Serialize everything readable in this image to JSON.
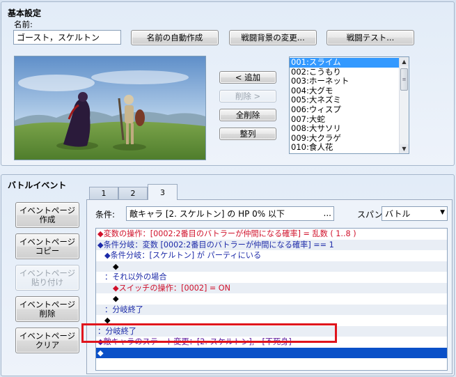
{
  "basic_settings": {
    "title": "基本設定",
    "name_label": "名前:",
    "name_value": "ゴースト，スケルトン",
    "auto_name_button": "名前の自動作成",
    "change_bg_button": "戦闘背景の変更...",
    "battle_test_button": "戦闘テスト...",
    "add_button": "< 追加",
    "remove_button": "削除 >",
    "clear_all_button": "全削除",
    "align_button": "整列"
  },
  "enemy_list": [
    "001:スライム",
    "002:こうもり",
    "003:ホーネット",
    "004:大グモ",
    "005:大ネズミ",
    "006:ウィスプ",
    "007:大蛇",
    "008:大サソリ",
    "009:大クラゲ",
    "010:食人花"
  ],
  "battle_event": {
    "title": "バトルイベント",
    "tabs": [
      "1",
      "2",
      "3"
    ],
    "active_tab": "3",
    "side_buttons": [
      {
        "label": "イベントページ\n作成",
        "enabled": true
      },
      {
        "label": "イベントページ\nコピー",
        "enabled": true
      },
      {
        "label": "イベントページ\n貼り付け",
        "enabled": false
      },
      {
        "label": "イベントページ\n削除",
        "enabled": true
      },
      {
        "label": "イベントページ\nクリア",
        "enabled": true
      }
    ],
    "condition_label": "条件:",
    "condition_value": "敵キャラ [2. スケルトン] の HP 0% 以下",
    "condition_ellipsis": "...",
    "span_label": "スパン:",
    "span_value": "バトル",
    "commands": [
      "◆変数の操作：[0002:2番目のバトラーが仲間になる確率] = 乱数 ( 1..8 )",
      "◆条件分岐：変数 [0002:2番目のバトラーが仲間になる確率] == 1",
      "◆条件分岐：[スケルトン] が パーティにいる",
      "◆",
      "：それ以外の場合",
      "◆スイッチの操作：[0002] = ON",
      "◆",
      "：分岐終了",
      "◆",
      "：分岐終了",
      "◆敵キャラのステート変更：[2. スケルトン], - [不死身]",
      "◆"
    ]
  },
  "colors": {
    "highlight_box": "#e0141c",
    "list_selection": "#3399ff",
    "command_selection": "#0a50c8"
  }
}
